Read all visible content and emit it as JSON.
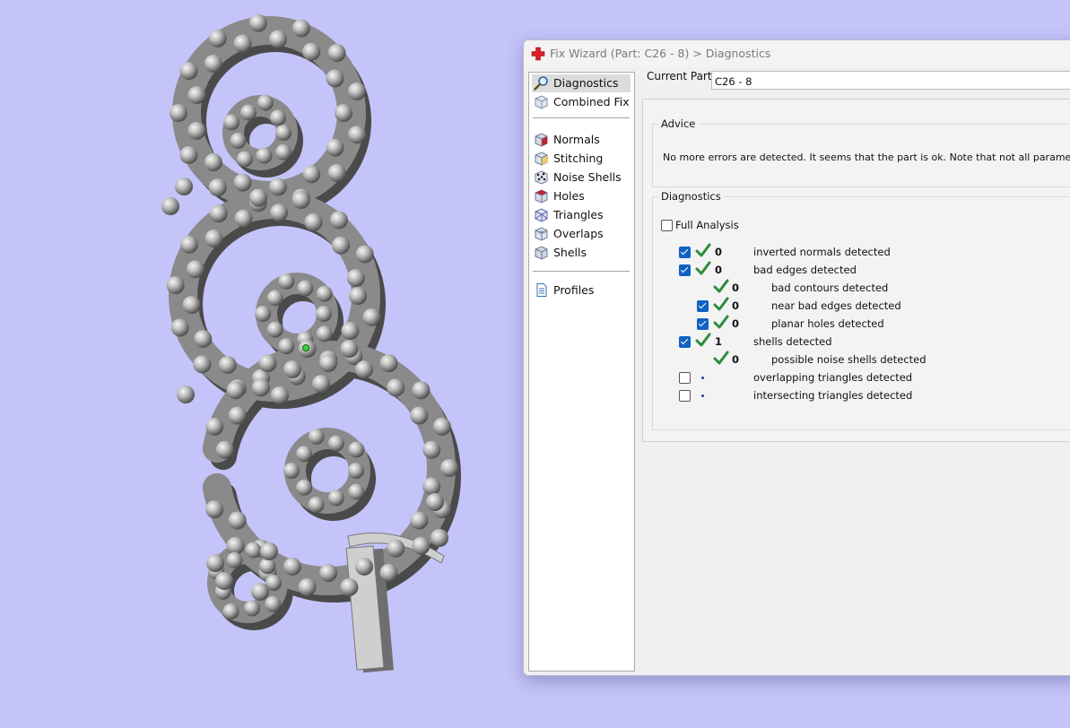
{
  "colors": {
    "background": "#c4c4fa",
    "check_green": "#2e8b3e",
    "checkbox_blue": "#0f62c3"
  },
  "window": {
    "title": "Fix Wizard (Part: C26 - 8) > Diagnostics",
    "icon": "red-cross-icon"
  },
  "nav": {
    "items": [
      {
        "label": "Diagnostics",
        "icon": "magnifier-icon",
        "selected": true
      },
      {
        "label": "Combined Fix",
        "icon": "cube-icon"
      },
      {
        "label": "Normals",
        "icon": "normals-cube-icon"
      },
      {
        "label": "Stitching",
        "icon": "stitching-cube-icon"
      },
      {
        "label": "Noise Shells",
        "icon": "noise-shells-icon"
      },
      {
        "label": "Holes",
        "icon": "holes-cube-icon"
      },
      {
        "label": "Triangles",
        "icon": "triangles-cube-icon"
      },
      {
        "label": "Overlaps",
        "icon": "overlaps-cube-icon"
      },
      {
        "label": "Shells",
        "icon": "shells-cube-icon"
      },
      {
        "label": "Profiles",
        "icon": "document-icon"
      }
    ]
  },
  "current_part": {
    "label": "Current Part:",
    "value": "C26 - 8"
  },
  "advice": {
    "title": "Advice",
    "text": "No more errors are detected. It seems that the part is ok. Note that not all parameters were ar"
  },
  "diagnostics": {
    "title": "Diagnostics",
    "full_analysis": {
      "label": "Full Analysis",
      "checked": false
    },
    "rows": [
      {
        "checked": true,
        "status": "ok",
        "count": "0",
        "label": "inverted normals detected"
      },
      {
        "checked": true,
        "status": "ok",
        "count": "0",
        "label": "bad edges detected"
      },
      {
        "checked": null,
        "status": "ok",
        "count": "0",
        "label": "bad contours detected"
      },
      {
        "checked": true,
        "status": "ok",
        "count": "0",
        "label": "near bad edges detected"
      },
      {
        "checked": true,
        "status": "ok",
        "count": "0",
        "label": "planar holes detected"
      },
      {
        "checked": true,
        "status": "ok",
        "count": "1",
        "label": "shells detected"
      },
      {
        "checked": null,
        "status": "ok",
        "count": "0",
        "label": "possible noise shells detected"
      },
      {
        "checked": false,
        "status": "pending",
        "count": "",
        "label": "overlapping triangles detected"
      },
      {
        "checked": false,
        "status": "pending",
        "count": "",
        "label": "intersecting triangles detected"
      }
    ]
  }
}
